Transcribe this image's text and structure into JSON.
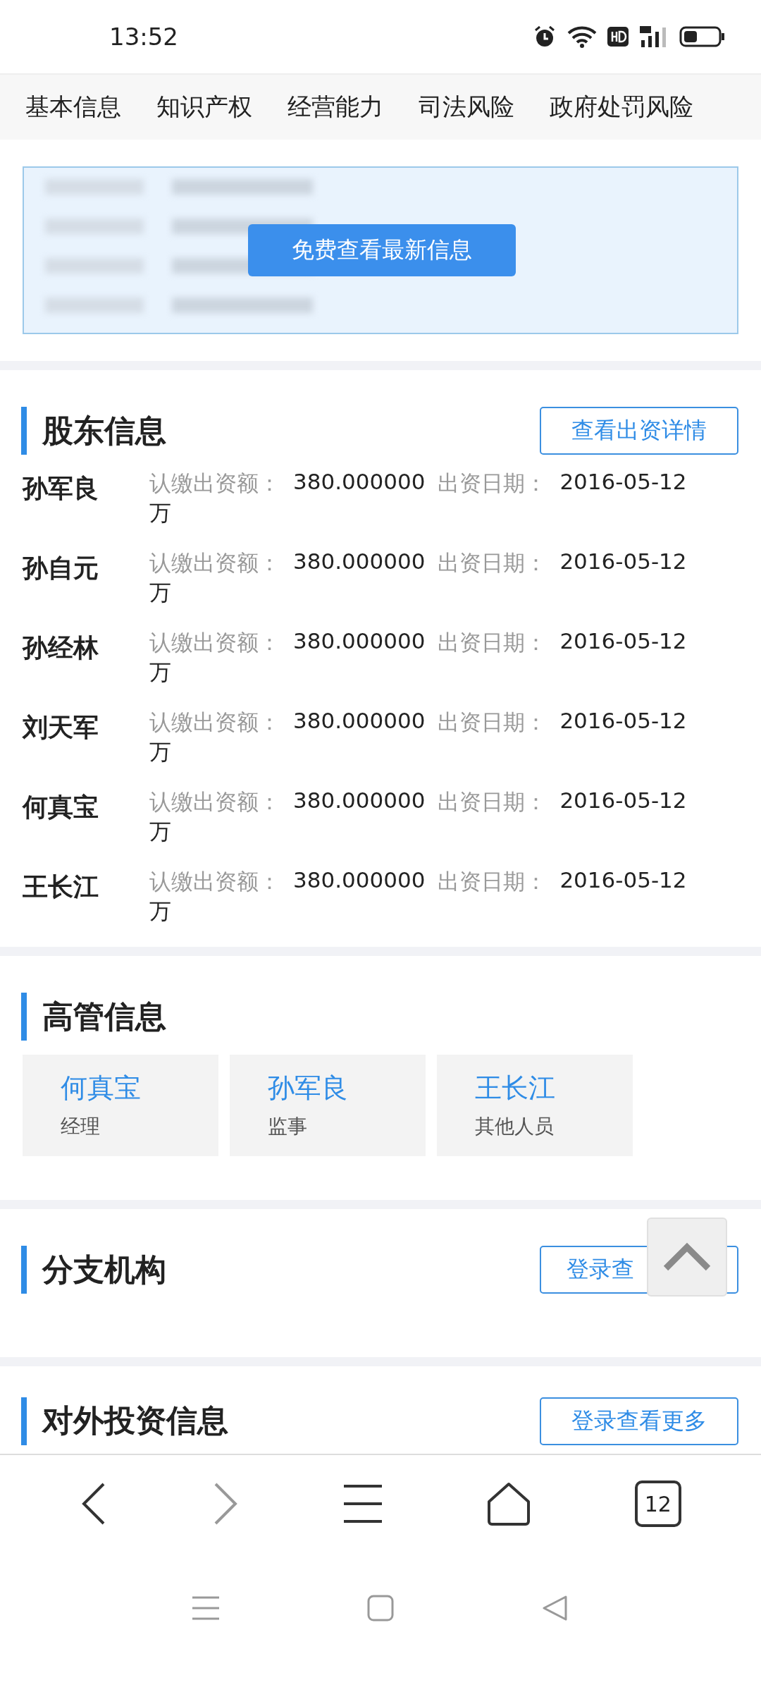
{
  "status_bar": {
    "time": "13:52"
  },
  "tabs": [
    {
      "label": "基本信息",
      "selected": false
    },
    {
      "label": "知识产权",
      "selected": false
    },
    {
      "label": "经营能力",
      "selected": false
    },
    {
      "label": "司法风险",
      "selected": false
    },
    {
      "label": "政府处罚风险",
      "selected": false
    }
  ],
  "financing": {
    "unlock_button": "免费查看最新信息"
  },
  "shareholders": {
    "title": "股东信息",
    "action": "查看出资详情",
    "rows": [
      {
        "name": "孙军良",
        "amount_label": "认缴出资额：",
        "amount": "380.000000",
        "unit": "万",
        "date_label": "出资日期：",
        "date": "2016-05-12"
      },
      {
        "name": "孙自元",
        "amount_label": "认缴出资额：",
        "amount": "380.000000",
        "unit": "万",
        "date_label": "出资日期：",
        "date": "2016-05-12"
      },
      {
        "name": "孙经林",
        "amount_label": "认缴出资额：",
        "amount": "380.000000",
        "unit": "万",
        "date_label": "出资日期：",
        "date": "2016-05-12"
      },
      {
        "name": "刘天军",
        "amount_label": "认缴出资额：",
        "amount": "380.000000",
        "unit": "万",
        "date_label": "出资日期：",
        "date": "2016-05-12"
      },
      {
        "name": "何真宝",
        "amount_label": "认缴出资额：",
        "amount": "380.000000",
        "unit": "万",
        "date_label": "出资日期：",
        "date": "2016-05-12"
      },
      {
        "name": "王长江",
        "amount_label": "认缴出资额：",
        "amount": "380.000000",
        "unit": "万",
        "date_label": "出资日期：",
        "date": "2016-05-12"
      }
    ]
  },
  "executives": {
    "title": "高管信息",
    "people": [
      {
        "name": "何真宝",
        "role": "经理"
      },
      {
        "name": "孙军良",
        "role": "监事"
      },
      {
        "name": "王长江",
        "role": "其他人员"
      }
    ]
  },
  "branches": {
    "title": "分支机构",
    "action": "登录查"
  },
  "investments": {
    "title": "对外投资信息",
    "action": "登录查看更多"
  },
  "browser_bar": {
    "tab_count": "12"
  }
}
